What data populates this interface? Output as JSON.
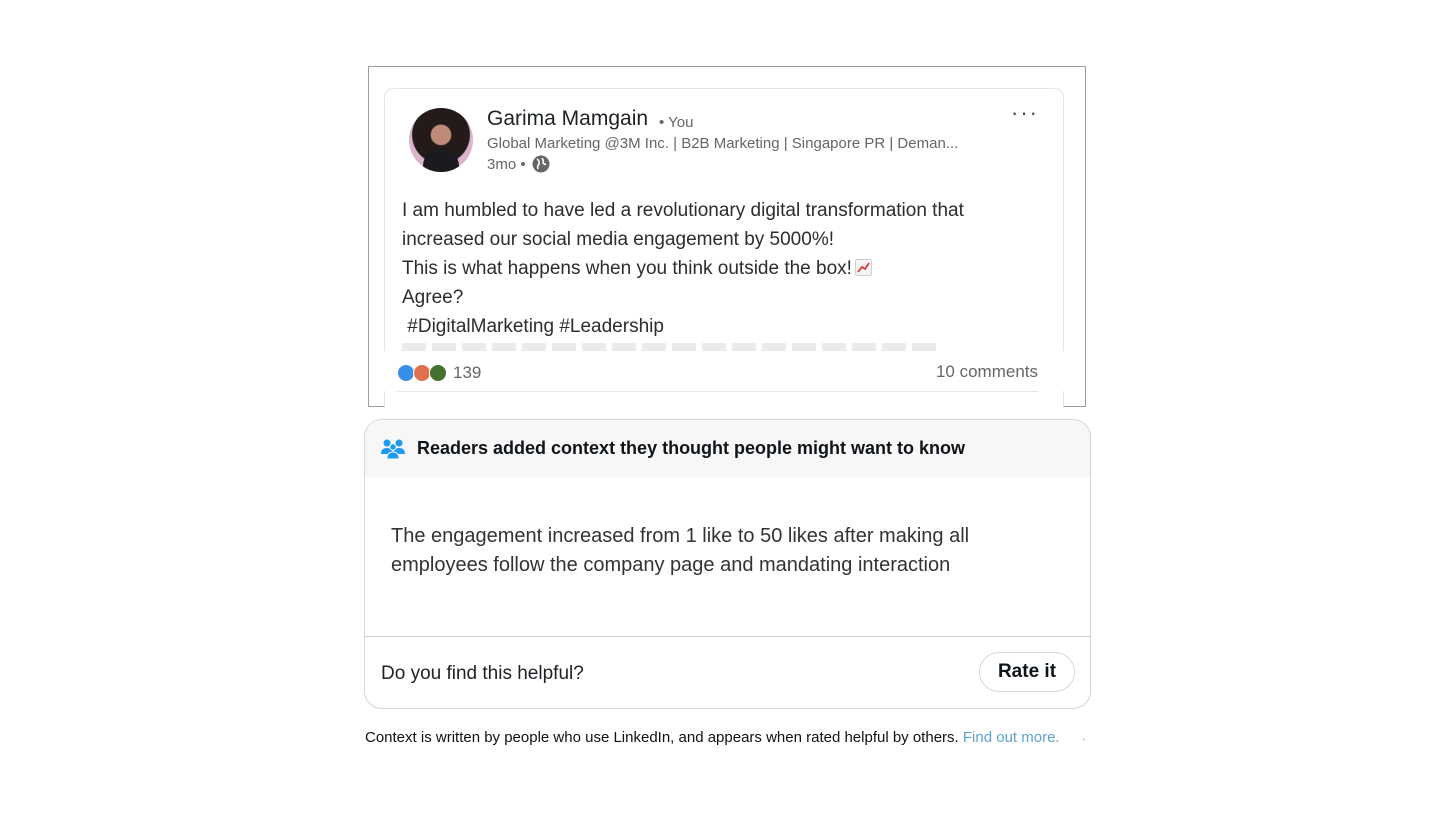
{
  "post": {
    "author_name": "Garima Mamgain",
    "connection": "• You",
    "headline": "Global Marketing @3M Inc. | B2B Marketing | Singapore PR | Deman...",
    "time": "3mo •",
    "more_label": "···",
    "body_lines": [
      "I am humbled to have led a revolutionary digital transformation that",
      "increased our social media engagement by 5000%!",
      "This is what happens when you think outside the box!",
      "Agree?",
      " #DigitalMarketing #Leadership"
    ],
    "emoji_icon": "chart-increasing-icon",
    "reaction_icons": [
      "like-icon",
      "love-icon",
      "celebrate-icon"
    ],
    "reaction_count": "139",
    "comments": "10 comments"
  },
  "note": {
    "header_icon": "people-icon",
    "title": "Readers added context they thought people might want to know",
    "body_lines": [
      "The engagement increased from 1 like to 50 likes after making all",
      "employees follow the company page and mandating interaction"
    ],
    "question": "Do you find this helpful?",
    "rate_label": "Rate it"
  },
  "footer": {
    "text": "Context is written by people who use LinkedIn, and appears when rated helpful by others.",
    "link": "Find out more.",
    "trailing": "."
  },
  "colors": {
    "link": "#5ba4cf",
    "people_icon": "#1d9bf0",
    "like": "#378fe9",
    "love": "#df704d",
    "celebrate": "#44712e"
  }
}
